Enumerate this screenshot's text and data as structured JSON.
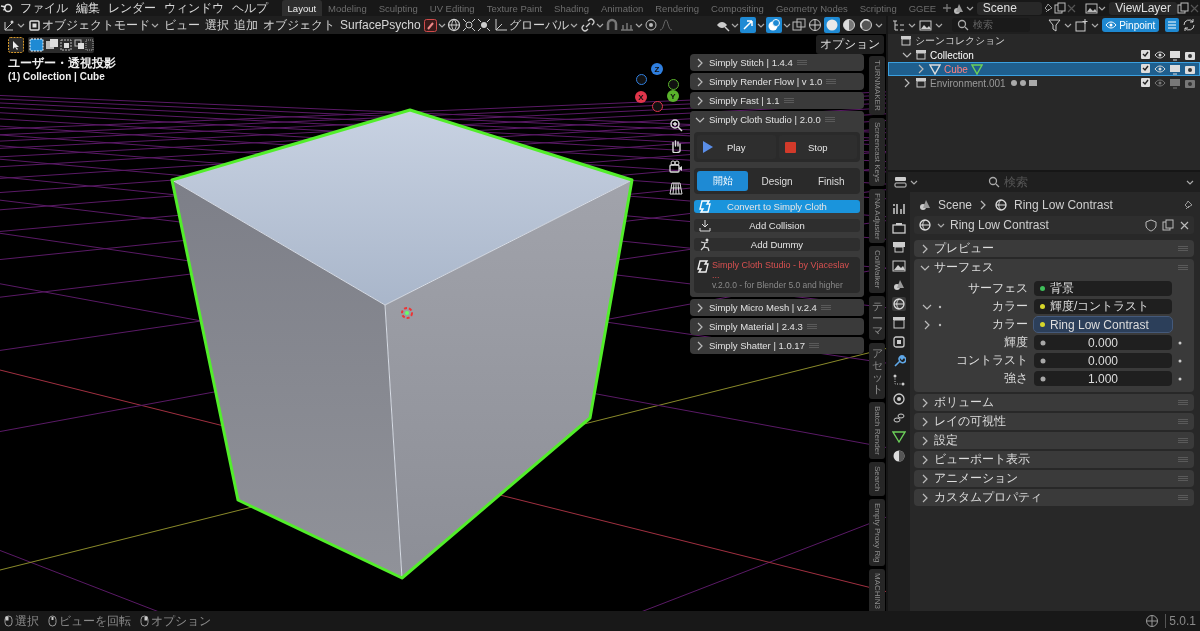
{
  "menu_bar": {
    "items": [
      "ファイル",
      "編集",
      "レンダー",
      "ウィンドウ",
      "ヘルプ"
    ]
  },
  "workspace_tabs": [
    {
      "label": "Layout",
      "selected": true
    },
    {
      "label": "Modeling",
      "selected": false
    },
    {
      "label": "Sculpting",
      "selected": false
    },
    {
      "label": "UV Editing",
      "selected": false
    },
    {
      "label": "Texture Paint",
      "selected": false
    },
    {
      "label": "Shading",
      "selected": false
    },
    {
      "label": "Animation",
      "selected": false
    },
    {
      "label": "Rendering",
      "selected": false
    },
    {
      "label": "Compositing",
      "selected": false
    },
    {
      "label": "Geometry Nodes",
      "selected": false
    },
    {
      "label": "Scripting",
      "selected": false
    },
    {
      "label": "GGEE",
      "selected": false
    }
  ],
  "scene": "Scene",
  "view_layer": "ViewLayer",
  "viewport_header": {
    "mode": "オブジェクトモード",
    "menus": [
      "ビュー",
      "選択",
      "追加",
      "オブジェクト",
      "SurfacePsycho"
    ],
    "orientation": "グローバル",
    "shading_modes": [
      {
        "kind": "wireframe",
        "selected": false
      },
      {
        "kind": "solid",
        "selected": true
      },
      {
        "kind": "material",
        "selected": false
      },
      {
        "kind": "rendered",
        "selected": false
      }
    ]
  },
  "viewport": {
    "options": "オプション",
    "view_name": "ユーザー・透視投影",
    "object_info": "(1) Collection | Cube",
    "gizmo_axes": [
      {
        "label": "Z",
        "color": "#2f7fe0"
      },
      {
        "label": "X",
        "color": "#e0354a"
      },
      {
        "label": "Y",
        "color": "#5ab32b"
      }
    ]
  },
  "sidebar_panels": [
    {
      "title": "Simply Stitch | 1.4.4",
      "expanded": false
    },
    {
      "title": "Simply Render Flow | v 1.0",
      "expanded": false
    },
    {
      "title": "Simply Fast | 1.1",
      "expanded": false
    },
    {
      "title": "Simply Cloth Studio | 2.0.0",
      "expanded": true,
      "content": {
        "play": "Play",
        "stop": "Stop",
        "stage_tabs": [
          {
            "label": "開始",
            "selected": true
          },
          {
            "label": "Design",
            "selected": false
          },
          {
            "label": "Finish",
            "selected": false
          }
        ],
        "convert": "Convert to Simply Cloth",
        "collision": "Add Collision",
        "dummy": "Add Dummy",
        "credit": "Simply Cloth Studio - by Vjaceslav ...",
        "version_note": "v.2.0.0 - for Blender 5.0 and higher"
      }
    },
    {
      "title": "Simply Micro Mesh | v.2.4",
      "expanded": false
    },
    {
      "title": "Simply Material | 2.4.3",
      "expanded": false
    },
    {
      "title": "Simply Shatter | 1.0.17",
      "expanded": false
    }
  ],
  "sidebar_tabs": [
    {
      "label": "TURNMAKER",
      "kind": "latin"
    },
    {
      "label": "Screencast Keys",
      "kind": "latin"
    },
    {
      "label": "FNA Adjuster",
      "kind": "latin"
    },
    {
      "label": "CollWalker",
      "kind": "latin"
    },
    {
      "label": "テーマ",
      "kind": "cjk"
    },
    {
      "label": "アセット",
      "kind": "cjk"
    },
    {
      "label": "Batch Render",
      "kind": "latin"
    },
    {
      "label": "Search",
      "kind": "latin"
    },
    {
      "label": "Empty Proxy Rig",
      "kind": "latin"
    },
    {
      "label": "MACHIN3",
      "kind": "latin"
    }
  ],
  "outliner": {
    "search_placeholder": "検索",
    "filter": "Pinpoint",
    "root": "シーンコレクション",
    "rows": [
      {
        "label": "Collection",
        "expanded": true,
        "selected": false,
        "children": [
          {
            "label": "Cube",
            "expanded": false,
            "selected": true
          }
        ]
      },
      {
        "label": "Environment.001",
        "expanded": false,
        "selected": false
      }
    ]
  },
  "properties": {
    "search_placeholder": "検索",
    "breadcrumb": [
      "Scene",
      "Ring Low Contrast"
    ],
    "world_name": "Ring Low Contrast",
    "sections": [
      {
        "title": "プレビュー",
        "expanded": false
      },
      {
        "title": "サーフェス",
        "expanded": true,
        "fields": [
          {
            "kind": "socket",
            "label": "サーフェス",
            "value": "背景",
            "color": "#3fbf5a"
          },
          {
            "kind": "input",
            "label": "カラー",
            "value": "輝度/コントラスト",
            "color": "#d6d62a",
            "expanded": true,
            "active": false
          },
          {
            "kind": "input",
            "label": "カラー",
            "value": "Ring Low Contrast",
            "color": "#d6d62a",
            "expanded": false,
            "active": true
          },
          {
            "kind": "number",
            "label": "輝度",
            "value": "0.000"
          },
          {
            "kind": "number",
            "label": "コントラスト",
            "value": "0.000"
          },
          {
            "kind": "number",
            "label": "強さ",
            "value": "1.000"
          }
        ]
      },
      {
        "title": "ボリューム",
        "expanded": false
      },
      {
        "title": "レイの可視性",
        "expanded": false
      },
      {
        "title": "設定",
        "expanded": false
      },
      {
        "title": "ビューポート表示",
        "expanded": false
      },
      {
        "title": "アニメーション",
        "expanded": false
      },
      {
        "title": "カスタムプロパティ",
        "expanded": false
      }
    ]
  },
  "status_bar": {
    "hints": [
      "選択",
      "ビューを回転",
      "オプション"
    ],
    "version": "5.0.1"
  }
}
